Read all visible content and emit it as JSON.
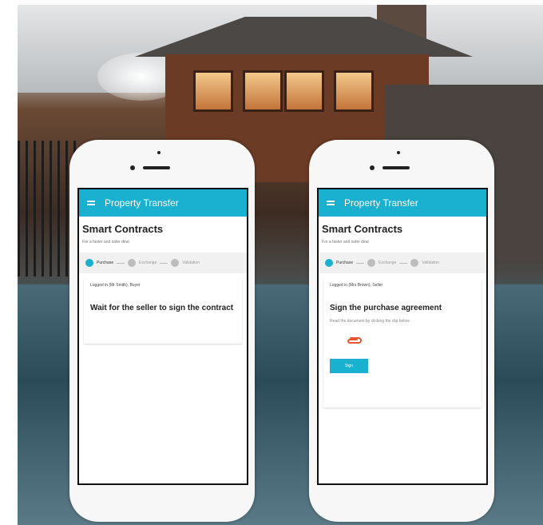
{
  "phone_left": {
    "appbar_title": "Property Transfer",
    "heading": "Smart Contracts",
    "subtitle": "For a faster and safer deal",
    "steps": [
      "Purchase",
      "Exchange",
      "Validation"
    ],
    "logged_in": "Logged in (Mr Smith), Buyer",
    "message": "Wait for the seller to sign the contract"
  },
  "phone_right": {
    "appbar_title": "Property Transfer",
    "heading": "Smart Contracts",
    "subtitle": "For a faster and safer deal",
    "steps": [
      "Purchase",
      "Exchange",
      "Validation"
    ],
    "logged_in": "Logged in (Mrs Brown), Seller",
    "task_title": "Sign the purchase agreement",
    "task_hint": "Read the document by clicking the clip below",
    "attachment_icon": "paperclip-icon",
    "button_label": "Sign"
  },
  "colors": {
    "accent": "#1ab0cf",
    "attachment": "#e8542f"
  }
}
